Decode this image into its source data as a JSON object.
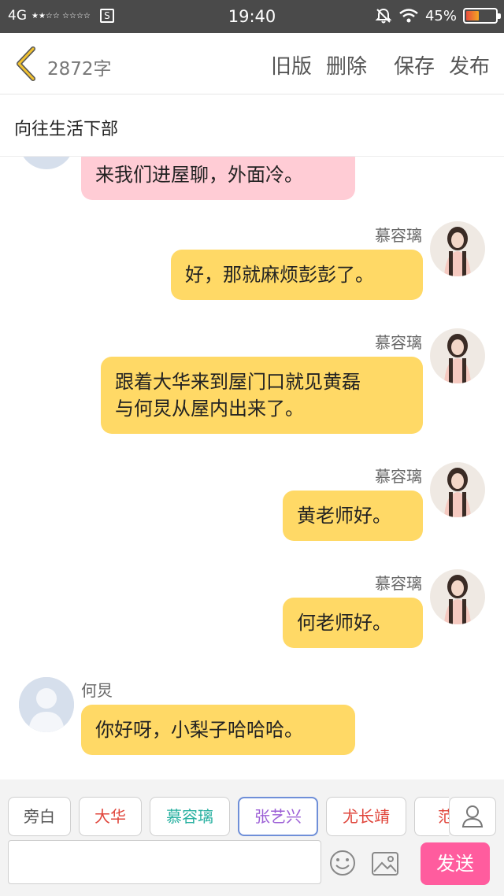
{
  "status_bar": {
    "network": "4G",
    "time": "19:40",
    "battery": "45%",
    "battery_level": 0.45
  },
  "toolbar": {
    "word_count": "2872字",
    "old_version": "旧版",
    "delete": "删除",
    "save": "保存",
    "publish": "发布"
  },
  "title": "向往生活下部",
  "messages": [
    {
      "side": "left",
      "speaker": "",
      "text": "来我们进屋聊，外面冷。",
      "color": "#ffccd5"
    },
    {
      "side": "right",
      "speaker": "慕容璃",
      "text": "好，那就麻烦彭彭了。",
      "color": "#ffd966"
    },
    {
      "side": "right",
      "speaker": "慕容璃",
      "text_line1": "跟着大华来到屋门口就见黄磊",
      "text_line2": "与何炅从屋内出来了。",
      "color": "#ffd966"
    },
    {
      "side": "right",
      "speaker": "慕容璃",
      "text": "黄老师好。",
      "color": "#ffd966"
    },
    {
      "side": "right",
      "speaker": "慕容璃",
      "text": "何老师好。",
      "color": "#ffd966"
    },
    {
      "side": "left",
      "speaker": "何炅",
      "text": "你好呀，小梨子哈哈哈。",
      "color": "#ffd966"
    }
  ],
  "characters": [
    {
      "label": "旁白",
      "color": "#555555"
    },
    {
      "label": "大华",
      "color": "#e0443a"
    },
    {
      "label": "慕容璃",
      "color": "#27b0a0"
    },
    {
      "label": "张艺兴",
      "color": "#9c5fd6"
    },
    {
      "label": "尤长靖",
      "color": "#e0443a"
    },
    {
      "label": "范",
      "color": "#e0443a"
    }
  ],
  "input": {
    "placeholder": ""
  },
  "send_label": "发送"
}
